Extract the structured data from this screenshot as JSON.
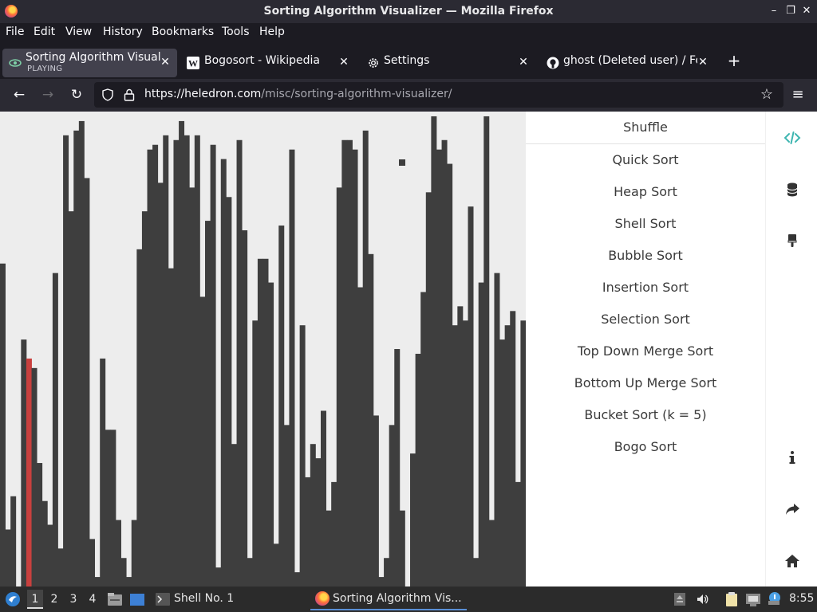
{
  "window": {
    "title": "Sorting Algorithm Visualizer — Mozilla Firefox"
  },
  "menubar": [
    "File",
    "Edit",
    "View",
    "History",
    "Bookmarks",
    "Tools",
    "Help"
  ],
  "tabs": [
    {
      "title": "Sorting Algorithm Visualizer",
      "subtitle": "PLAYING",
      "icon": "sort-favicon-icon"
    },
    {
      "title": "Bogosort - Wikipedia",
      "icon": "wikipedia-w-icon"
    },
    {
      "title": "Settings",
      "icon": "gear-icon"
    },
    {
      "title": "ghost (Deleted user) / Fo",
      "icon": "github-icon"
    }
  ],
  "urlbar": {
    "host": "https://heledron.com",
    "path": "/misc/sorting-algorithm-visualizer/"
  },
  "algorithms": [
    "Shuffle",
    "Quick Sort",
    "Heap Sort",
    "Shell Sort",
    "Bubble Sort",
    "Insertion Sort",
    "Selection Sort",
    "Top Down Merge Sort",
    "Bottom Up Merge Sort",
    "Bucket Sort (k = 5)",
    "Bogo Sort"
  ],
  "rail_icons": [
    "code-icon",
    "database-icon",
    "brush-icon",
    "info-icon",
    "share-icon",
    "home-icon"
  ],
  "bars": {
    "values": [
      68,
      12,
      19,
      0,
      52,
      48,
      46,
      26,
      18,
      13,
      66,
      8,
      95,
      79,
      96,
      98,
      86,
      10,
      2,
      48,
      33,
      33,
      14,
      6,
      2,
      14,
      71,
      79,
      92,
      93,
      85,
      95,
      67,
      94,
      98,
      95,
      84,
      95,
      61,
      77,
      93,
      4,
      90,
      82,
      30,
      94,
      75,
      6,
      56,
      69,
      69,
      64,
      9,
      76,
      34,
      92,
      3,
      55,
      23,
      30,
      27,
      37,
      16,
      22,
      84,
      94,
      94,
      92,
      63,
      96,
      70,
      36,
      2,
      6,
      34,
      50,
      16,
      0,
      28,
      49,
      62,
      83,
      99,
      92,
      94,
      89,
      55,
      59,
      56,
      80,
      6,
      64,
      99,
      14,
      66,
      52,
      55,
      58,
      22,
      56
    ],
    "max": 100,
    "highlight_indexes": [
      5,
      77
    ],
    "bar_color": "#3e3e3e",
    "highlight_color": "#c9403e",
    "background": "#ededed",
    "stray_marker": true
  },
  "taskbar": {
    "workspaces": [
      "1",
      "2",
      "3",
      "4"
    ],
    "active_workspace": "1",
    "terminal": "Shell No. 1",
    "firefox": "Sorting Algorithm Vis...",
    "clock": "8:55"
  }
}
